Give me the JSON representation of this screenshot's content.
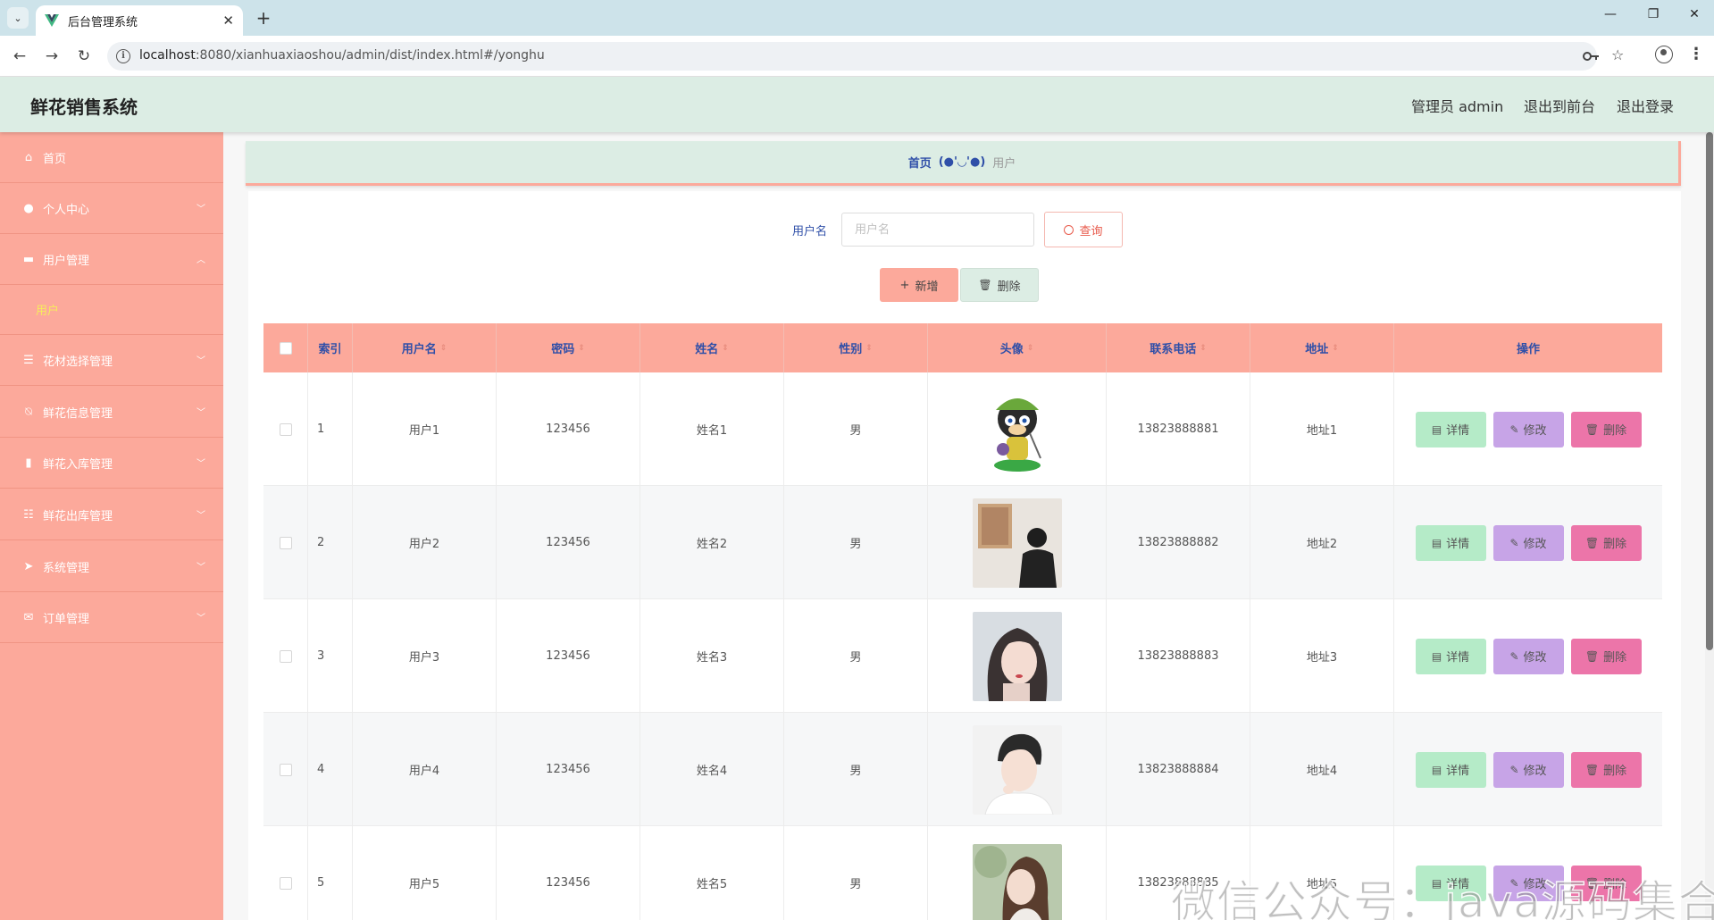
{
  "browser": {
    "tab_title": "后台管理系统",
    "tab_close": "✕",
    "new_tab": "+",
    "url_host": "localhost",
    "url_path": ":8080/xianhuaxiaoshou/admin/dist/index.html#/yonghu",
    "icons": [
      "tab-list-icon",
      "vue-logo-icon",
      "back-icon",
      "forward-icon",
      "reload-icon",
      "site-info-icon",
      "password-key-icon",
      "bookmark-star-icon",
      "profile-icon",
      "menu-kebab-icon",
      "minimize-icon",
      "restore-icon",
      "close-icon"
    ]
  },
  "header": {
    "title": "鲜花销售系统",
    "admin_label": "管理员 admin",
    "to_front": "退出到前台",
    "logout": "退出登录",
    "bg_color": "#dcede4"
  },
  "sidebar": {
    "bg_color": "#fca99b",
    "items": [
      {
        "label": "首页",
        "icon": "home-icon"
      },
      {
        "label": "个人中心",
        "icon": "user-icon"
      },
      {
        "label": "用户管理",
        "icon": "chat-icon",
        "expanded": true
      },
      {
        "label": "花材选择管理",
        "icon": "menu-lines-icon"
      },
      {
        "label": "鲜花信息管理",
        "icon": "bell-off-icon"
      },
      {
        "label": "鲜花入库管理",
        "icon": "document-icon"
      },
      {
        "label": "鲜花出库管理",
        "icon": "sliders-icon"
      },
      {
        "label": "系统管理",
        "icon": "send-icon"
      },
      {
        "label": "订单管理",
        "icon": "message-icon"
      }
    ],
    "sub_item": "用户",
    "sub_item_color": "#f6ec5c"
  },
  "breadcrumb": {
    "home": "首页",
    "separator": "(●'◡'●)",
    "current": "用户"
  },
  "search": {
    "label": "用户名",
    "placeholder": "用户名",
    "query_button": "查询",
    "add_button": "新增",
    "delete_button": "删除"
  },
  "table": {
    "header_color": "#fca99b",
    "columns": [
      "索引",
      "用户名",
      "密码",
      "姓名",
      "性别",
      "头像",
      "联系电话",
      "地址",
      "操作"
    ],
    "rows": [
      {
        "index": "1",
        "username": "用户1",
        "password": "123456",
        "name": "姓名1",
        "gender": "男",
        "phone": "13823888881",
        "address": "地址1"
      },
      {
        "index": "2",
        "username": "用户2",
        "password": "123456",
        "name": "姓名2",
        "gender": "男",
        "phone": "13823888882",
        "address": "地址2"
      },
      {
        "index": "3",
        "username": "用户3",
        "password": "123456",
        "name": "姓名3",
        "gender": "男",
        "phone": "13823888883",
        "address": "地址3"
      },
      {
        "index": "4",
        "username": "用户4",
        "password": "123456",
        "name": "姓名4",
        "gender": "男",
        "phone": "13823888884",
        "address": "地址4"
      },
      {
        "index": "5",
        "username": "用户5",
        "password": "123456",
        "name": "姓名5",
        "gender": "男",
        "phone": "13823888885",
        "address": "地址5"
      }
    ],
    "actions": {
      "detail": "详情",
      "edit": "修改",
      "delete": "删除"
    },
    "action_colors": {
      "detail": "#b5ebc8",
      "edit": "#c7a4e7",
      "delete": "#ec75a9"
    }
  },
  "watermark": "微信公众号：java源码集合"
}
